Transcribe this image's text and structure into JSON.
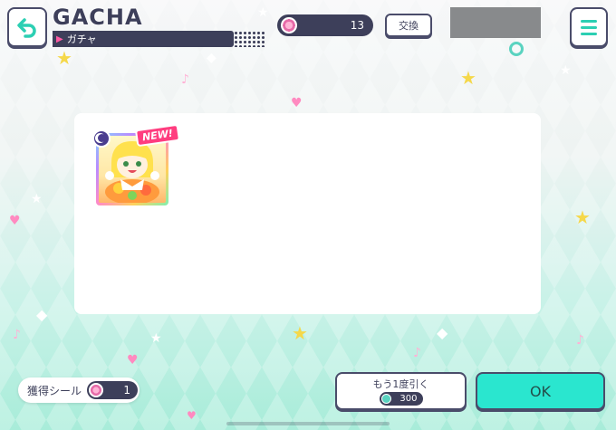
{
  "header": {
    "title": "GACHA",
    "subtitle": "ガチャ",
    "back_icon": "back-arrow-icon",
    "menu_icon": "hamburger-menu-icon"
  },
  "currency": {
    "icon": "disc-coin-icon",
    "value": "13",
    "exchange_label": "交換"
  },
  "result": {
    "cards": [
      {
        "badge": "NEW!",
        "attribute_icon": "moon-icon"
      }
    ]
  },
  "footer": {
    "sticker_label": "獲得シール",
    "sticker_count": "1",
    "again_label": "もう1度引く",
    "again_cost": "300",
    "again_cost_icon": "gem-icon",
    "ok_label": "OK"
  },
  "colors": {
    "accent": "#2ae6cf",
    "navy": "#3d3f5a",
    "pink": "#ff3d7f"
  }
}
